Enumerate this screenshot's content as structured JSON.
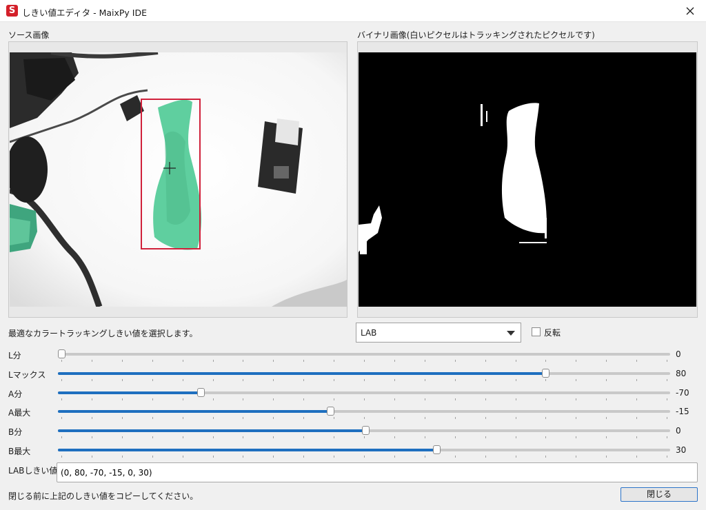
{
  "window": {
    "title": "しきい値エディタ - MaixPy IDE",
    "icon_letter": "S"
  },
  "source_pane": {
    "label": "ソース画像"
  },
  "binary_pane": {
    "label": "バイナリ画像(白いピクセルはトラッキングされたピクセルです)"
  },
  "controls": {
    "description": "最適なカラートラッキングしきい値を選択します。",
    "color_space": {
      "selected": "LAB"
    },
    "invert": {
      "label": "反転",
      "checked": false
    }
  },
  "sliders": [
    {
      "label": "L分",
      "value": "0",
      "fraction": 0.0
    },
    {
      "label": "Lマックス",
      "value": "80",
      "fraction": 0.8
    },
    {
      "label": "A分",
      "value": "-70",
      "fraction": 0.23
    },
    {
      "label": "A最大",
      "value": "-15",
      "fraction": 0.445
    },
    {
      "label": "B分",
      "value": "0",
      "fraction": 0.503
    },
    {
      "label": "B最大",
      "value": "30",
      "fraction": 0.62
    }
  ],
  "threshold": {
    "label": "LABしきい値",
    "value": "(0, 80, -70, -15, 0, 30)"
  },
  "footer": {
    "note": "閉じる前に上記のしきい値をコピーしてください。",
    "close_button": "閉じる"
  },
  "colors": {
    "accent": "#1e6fbf",
    "tracked_fill": "#5fcf9f",
    "bbox": "#d0203a"
  }
}
